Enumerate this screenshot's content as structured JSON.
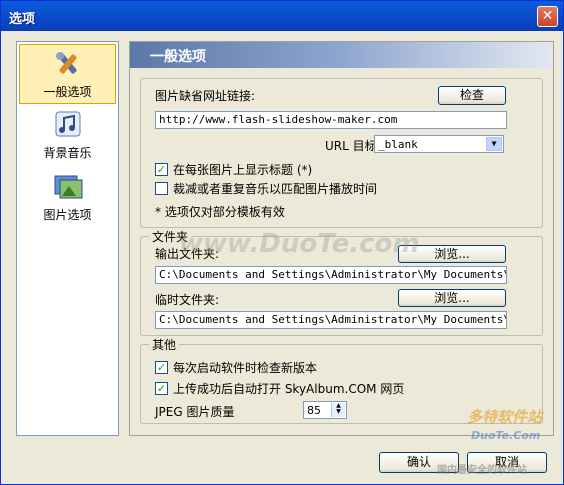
{
  "window": {
    "title": "选项",
    "close_glyph": "✕"
  },
  "sidebar": {
    "items": [
      {
        "label": "一般选项",
        "icon": "tools-icon",
        "active": true
      },
      {
        "label": "背景音乐",
        "icon": "music-note-icon",
        "active": false
      },
      {
        "label": "图片选项",
        "icon": "picture-icon",
        "active": false
      }
    ]
  },
  "panel": {
    "title": "一般选项"
  },
  "general": {
    "url_label": "图片缺省网址链接:",
    "check_button": "检查",
    "url_value": "http://www.flash-slideshow-maker.com",
    "target_label": "URL 目标:",
    "target_value": "_blank",
    "show_title_label": "在每张图片上显示标题 (*)",
    "show_title_checked": true,
    "trim_music_label": "裁减或者重复音乐以匹配图片播放时间",
    "trim_music_checked": false,
    "note": "* 选项仅对部分模板有效"
  },
  "folders": {
    "group_title": "文件夹",
    "output_label": "输出文件夹:",
    "browse_label": "浏览...",
    "output_path": "C:\\Documents and Settings\\Administrator\\My Documents\\Flash",
    "temp_label": "临时文件夹:",
    "temp_path": "C:\\Documents and Settings\\Administrator\\My Documents\\Flash"
  },
  "other": {
    "group_title": "其他",
    "check_update_label": "每次启动软件时检查新版本",
    "check_update_checked": true,
    "open_page_label": "上传成功后自动打开 SkyAlbum.COM 网页",
    "open_page_checked": true,
    "jpeg_label": "JPEG 图片质量",
    "jpeg_value": "85"
  },
  "footer": {
    "ok_label": "确认",
    "cancel_label": "取消"
  },
  "watermark": {
    "text1": "www.DuoTe.com",
    "text2": "多特软件站",
    "text3": "DuoTe.Com",
    "text4": "国内最安全的软件站"
  }
}
